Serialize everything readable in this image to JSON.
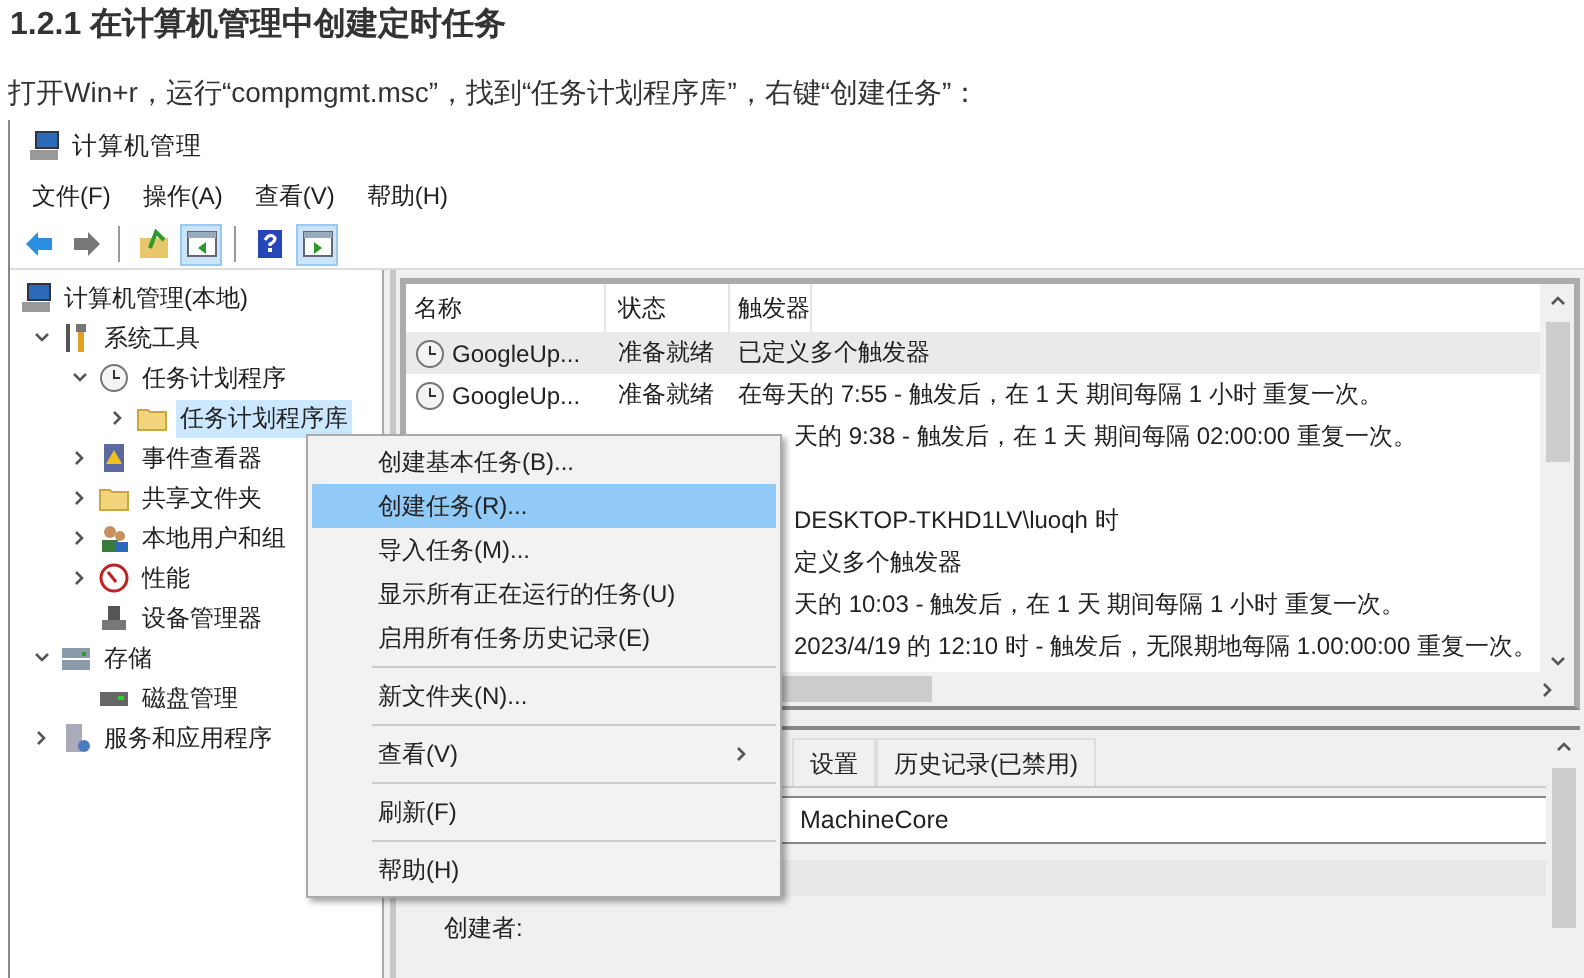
{
  "heading": "1.2.1 在计算机管理中创建定时任务",
  "intro": "打开Win+r，运行“compmgmt.msc”，找到“任务计划程序库”，右键“创建任务”：",
  "window": {
    "title": "计算机管理"
  },
  "menu_bar": [
    "文件(F)",
    "操作(A)",
    "查看(V)",
    "帮助(H)"
  ],
  "toolbar": [
    {
      "kind": "back",
      "on": false
    },
    {
      "kind": "forward",
      "on": false
    },
    {
      "kind": "up",
      "on": false
    },
    {
      "kind": "pane",
      "on": true
    },
    {
      "kind": "help",
      "on": false
    },
    {
      "kind": "pane2",
      "on": true
    }
  ],
  "tree": [
    {
      "label": "计算机管理(本地)",
      "kind": "computer",
      "selected": false,
      "children": [
        {
          "label": "系统工具",
          "kind": "tools",
          "expanded": true,
          "selected": false,
          "children": [
            {
              "label": "任务计划程序",
              "kind": "clock",
              "expanded": true,
              "selected": false,
              "children": [
                {
                  "label": "任务计划程序库",
                  "kind": "folder",
                  "expanded": false,
                  "selected": true
                }
              ]
            },
            {
              "label": "事件查看器",
              "kind": "log",
              "expanded": false,
              "selected": false
            },
            {
              "label": "共享文件夹",
              "kind": "folder",
              "expanded": false,
              "selected": false
            },
            {
              "label": "本地用户和组",
              "kind": "users",
              "expanded": false,
              "selected": false
            },
            {
              "label": "性能",
              "kind": "gauge",
              "expanded": false,
              "selected": false
            },
            {
              "label": "设备管理器",
              "kind": "device",
              "selected": false
            }
          ]
        },
        {
          "label": "存储",
          "kind": "drive",
          "expanded": true,
          "selected": false,
          "children": [
            {
              "label": "磁盘管理",
              "kind": "disk",
              "selected": false
            }
          ]
        },
        {
          "label": "服务和应用程序",
          "kind": "server",
          "expanded": false,
          "selected": false
        }
      ]
    }
  ],
  "table": {
    "columns": [
      "名称",
      "状态",
      "触发器"
    ],
    "rows": [
      {
        "name": "GoogleUp...",
        "status": "准备就绪",
        "trigger": "已定义多个触发器",
        "selected": true
      },
      {
        "name": "GoogleUp...",
        "status": "准备就绪",
        "trigger": "在每天的 7:55 - 触发后，在 1 天 期间每隔 1 小时 重复一次。",
        "selected": false
      },
      {
        "trigger": "天的 9:38 - 触发后，在 1 天 期间每隔 02:00:00 重复一次。",
        "selected": false
      },
      {
        "selected": false
      },
      {
        "trigger": "DESKTOP-TKHD1LV\\luoqh 时",
        "selected": false
      },
      {
        "trigger": "定义多个触发器",
        "selected": false
      },
      {
        "trigger": "天的 10:03 - 触发后，在 1 天 期间每隔 1 小时 重复一次。",
        "selected": false
      },
      {
        "trigger": "2023/4/19 的 12:10 时 - 触发后，无限期地每隔 1.00:00:00 重复一次。",
        "selected": false
      }
    ]
  },
  "detail": {
    "tabs": [
      {
        "label": "设置",
        "selected": false
      },
      {
        "label": "历史记录(已禁用)",
        "selected": false
      }
    ],
    "field": "MachineCore",
    "label": "创建者:"
  },
  "context_menu": [
    {
      "kind": "item",
      "label": "创建基本任务(B)...",
      "selected": false
    },
    {
      "kind": "item",
      "label": "创建任务(R)...",
      "selected": true
    },
    {
      "kind": "item",
      "label": "导入任务(M)...",
      "selected": false
    },
    {
      "kind": "item",
      "label": "显示所有正在运行的任务(U)",
      "selected": false
    },
    {
      "kind": "item",
      "label": "启用所有任务历史记录(E)",
      "selected": false
    },
    {
      "kind": "separator"
    },
    {
      "kind": "item",
      "label": "新文件夹(N)...",
      "selected": false
    },
    {
      "kind": "separator"
    },
    {
      "kind": "submenu",
      "label": "查看(V)",
      "selected": false
    },
    {
      "kind": "separator"
    },
    {
      "kind": "item",
      "label": "刷新(F)",
      "selected": false
    },
    {
      "kind": "separator"
    },
    {
      "kind": "item",
      "label": "帮助(H)",
      "selected": false
    }
  ]
}
